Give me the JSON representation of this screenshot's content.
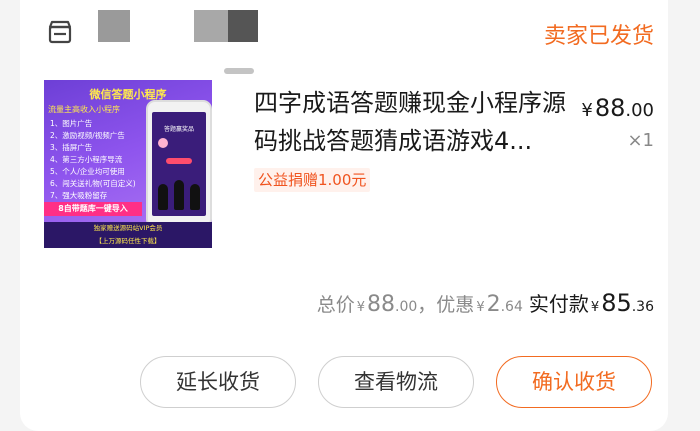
{
  "order": {
    "status": "卖家已发货",
    "shop_icon": "store-icon",
    "colors": {
      "accent": "#f26b21",
      "charity_bg": "#fff1ec",
      "charity_text": "#f0541f"
    }
  },
  "product": {
    "title": "四字成语答题赚现金小程序源码挑战答题猜成语游戏4...",
    "price_symbol": "¥",
    "price_int": "88",
    "price_dec": ".00",
    "quantity": "×1",
    "charity": "公益捐赠1.00元",
    "thumbnail": {
      "heading": "微信答题小程序",
      "subheading": "流量主高收入小程序",
      "features": [
        "1、图片广告",
        "2、激励视频/视频广告",
        "3、插屏广告",
        "4、第三方小程序导流",
        "5、个人/企业均可使用",
        "6、闯关送礼物(可自定义)",
        "7、强大吸粉留存"
      ],
      "tag": "8自带题库一键导入",
      "footer_line1": "独家赠送源码站VIP会员",
      "footer_line2": "【上万源码任性下载】",
      "screen_title": "答题赢奖品"
    }
  },
  "summary": {
    "total_label": "总价",
    "total_symbol": "¥",
    "total_int": "88",
    "total_dec": ".00",
    "separator": "，",
    "discount_label": "优惠",
    "discount_symbol": "¥",
    "discount_int": "2",
    "discount_dec": ".64",
    "paid_label": "实付款",
    "paid_symbol": "¥",
    "paid_int": "85",
    "paid_dec": ".36"
  },
  "actions": {
    "extend_label": "延长收货",
    "logistics_label": "查看物流",
    "confirm_label": "确认收货"
  }
}
